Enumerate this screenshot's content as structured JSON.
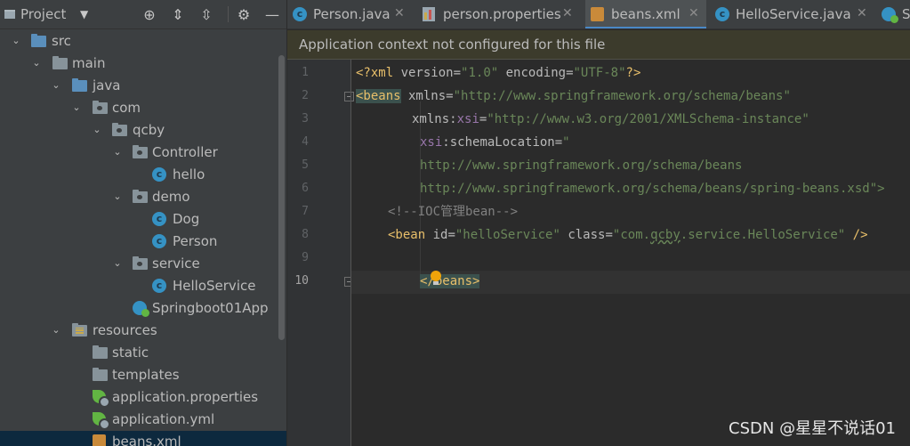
{
  "project_panel": {
    "title": "Project",
    "header_buttons": [
      "locate-icon",
      "expand-all-icon",
      "collapse-all-icon",
      "gear-icon",
      "minimize-icon"
    ]
  },
  "tree": [
    {
      "label": "src",
      "icon": "folder-src-icon",
      "expanded": true
    },
    {
      "label": "main",
      "icon": "folder-icon",
      "expanded": true
    },
    {
      "label": "java",
      "icon": "folder-java-icon",
      "expanded": true
    },
    {
      "label": "com",
      "icon": "package-icon",
      "expanded": true
    },
    {
      "label": "qcby",
      "icon": "package-icon",
      "expanded": true
    },
    {
      "label": "Controller",
      "icon": "package-icon",
      "expanded": true
    },
    {
      "label": "hello",
      "icon": "class-icon"
    },
    {
      "label": "demo",
      "icon": "package-icon",
      "expanded": true
    },
    {
      "label": "Dog",
      "icon": "class-icon"
    },
    {
      "label": "Person",
      "icon": "class-icon"
    },
    {
      "label": "service",
      "icon": "package-icon",
      "expanded": true
    },
    {
      "label": "HelloService",
      "icon": "class-icon"
    },
    {
      "label": "Springboot01App",
      "icon": "spring-app-icon"
    },
    {
      "label": "resources",
      "icon": "resources-folder-icon",
      "expanded": true
    },
    {
      "label": "static",
      "icon": "folder-icon"
    },
    {
      "label": "templates",
      "icon": "folder-icon"
    },
    {
      "label": "application.properties",
      "icon": "spring-config-icon"
    },
    {
      "label": "application.yml",
      "icon": "spring-config-icon"
    },
    {
      "label": "beans.xml",
      "icon": "xml-file-icon",
      "selected": true
    }
  ],
  "tabs": [
    {
      "label": "Person.java",
      "icon": "class-icon"
    },
    {
      "label": "person.properties",
      "icon": "properties-file-icon"
    },
    {
      "label": "beans.xml",
      "icon": "xml-file-icon",
      "active": true
    },
    {
      "label": "HelloService.java",
      "icon": "class-icon"
    },
    {
      "label": "S",
      "icon": "spring-app-icon"
    }
  ],
  "banner": {
    "text": "Application context not configured for this file"
  },
  "editor": {
    "line_numbers": [
      "1",
      "2",
      "3",
      "4",
      "5",
      "6",
      "7",
      "8",
      "9",
      "10"
    ],
    "current_line": "10",
    "lines": {
      "l1": {
        "a": "<?xml ",
        "b": "version",
        "c": "=",
        "d": "\"1.0\"",
        "e": " ",
        "f": "encoding",
        "g": "=",
        "h": "\"UTF-8\"",
        "i": "?>"
      },
      "l2": {
        "a": "<beans",
        "b": " xmlns",
        "c": "=",
        "d": "\"http://www.springframework.org/schema/beans\""
      },
      "l3": {
        "a": "xmlns",
        "b": ":",
        "c": "xsi",
        "d": "=",
        "e": "\"http://www.w3.org/2001/XMLSchema-instance\""
      },
      "l4": {
        "a": "xsi",
        "b": ":schemaLocation",
        "c": "=",
        "d": "\""
      },
      "l5": {
        "a": "http://www.springframework.org/schema/beans"
      },
      "l6": {
        "a": "http://www.springframework.org/schema/beans/spring-beans.xsd\">"
      },
      "l7": {
        "a": "<!--IOC管理bean-->"
      },
      "l8": {
        "a": "<bean ",
        "b": "id",
        "c": "=",
        "d": "\"helloService\"",
        "e": " ",
        "f": "class",
        "g": "=",
        "h": "\"com.",
        "i": "qcby",
        "j": ".service.HelloService\"",
        "k": " />"
      },
      "l10": {
        "a": "</beans>"
      }
    }
  },
  "watermark": "CSDN @星星不说话01",
  "colors": {
    "accent": "#4a88c7",
    "tag": "#e8bf6a",
    "string": "#6a8759",
    "namespace": "#9876aa",
    "comment": "#808080"
  }
}
